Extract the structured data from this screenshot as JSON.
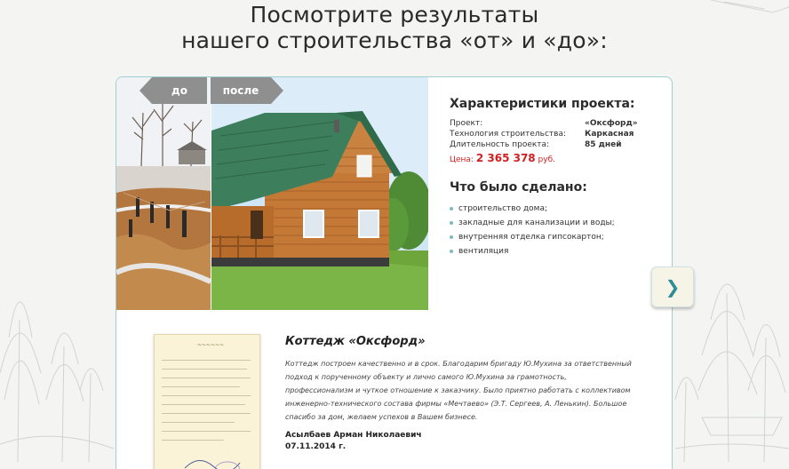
{
  "heading": {
    "line1": "Посмотрите результаты",
    "line2": "нашего строительства «от» и «до»:"
  },
  "gallery": {
    "before_label": "до",
    "after_label": "после"
  },
  "specs": {
    "title": "Характеристики проекта:",
    "rows": [
      {
        "key": "Проект:",
        "value": "«Оксфорд»"
      },
      {
        "key": "Технология строительства:",
        "value": "Каркасная"
      },
      {
        "key": "Длительность проекта:",
        "value": "85 дней"
      }
    ],
    "price_label": "Цена:",
    "price_value": "2 365 378",
    "price_unit": "руб."
  },
  "done": {
    "title": "Что было сделано:",
    "items": [
      "строительство дома;",
      "закладные для канализации и воды;",
      "внутренняя отделка гипсокартон;",
      "вентиляция"
    ]
  },
  "review": {
    "title": "Коттедж «Оксфорд»",
    "text": "Коттедж построен качественно и в срок. Благодарим бригаду Ю.Мухина за ответственный подход к порученному объекту и лично самого Ю.Мухина за грамотность, профессионализм и чуткое отношение к заказчику. Было приятно работать с коллективом инженерно-технического состава фирмы «Мечтаево» (Э.Т. Сергеев, А. Ленькин). Большое спасибо за дом, желаем успехов в Вашем бизнесе.",
    "author": "Асылбаев Арман Николаевич",
    "date": "07.11.2014 г."
  },
  "colors": {
    "accent": "#2f8d97",
    "price": "#d21e1e",
    "border": "#9fcfd0"
  },
  "icons": {
    "next": "chevron-right-icon"
  }
}
